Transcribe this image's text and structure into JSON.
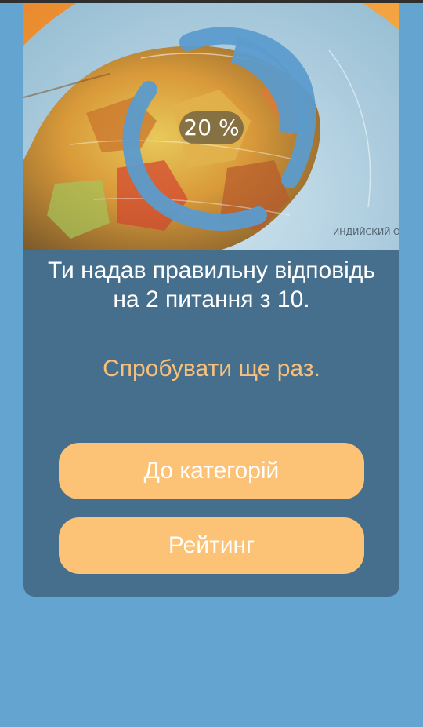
{
  "hero": {
    "progress_percent": 20,
    "progress_label": "20 %",
    "map_caption": "ИНДИЙСКИЙ ОКЕА"
  },
  "result": {
    "message": "Ти надав правильну відповідь на 2 питання з 10.",
    "retry_label": "Спробувати ще раз."
  },
  "buttons": {
    "categories_label": "До категорій",
    "rating_label": "Рейтинг"
  },
  "colors": {
    "background": "#63a4d0",
    "card": "#466f8d",
    "accent": "#fcc275",
    "retry_text": "#f7c07b",
    "ring": "#5b9bcc"
  }
}
